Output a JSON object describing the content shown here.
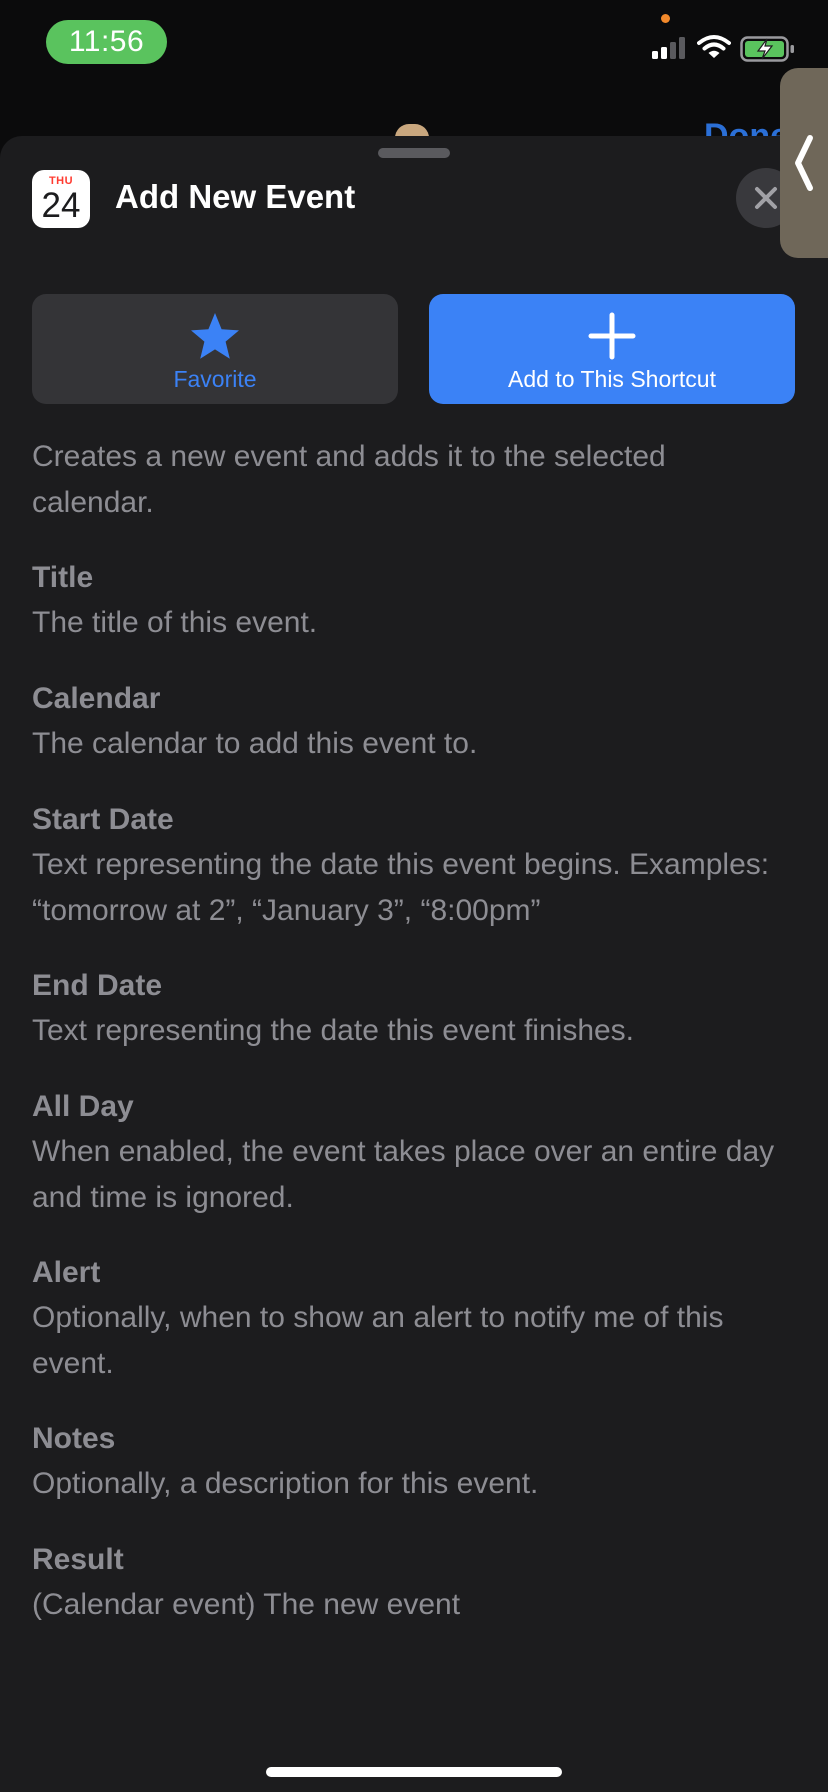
{
  "status_bar": {
    "time": "11:56",
    "signal_icon": "cellular-signal-icon",
    "wifi_icon": "wifi-icon",
    "battery_icon": "battery-charging-icon",
    "time_pill_color": "#5ac35e"
  },
  "background": {
    "nav_right_label": "Done"
  },
  "sheet": {
    "app_icon": {
      "day": "THU",
      "date": "24"
    },
    "title": "Add New Event",
    "close_icon": "close-icon",
    "buttons": {
      "favorite_label": "Favorite",
      "add_label": "Add to This Shortcut"
    },
    "description": "Creates a new event and adds it to the selected calendar.",
    "parameters": [
      {
        "name": "Title",
        "text": "The title of this event."
      },
      {
        "name": "Calendar",
        "text": "The calendar to add this event to."
      },
      {
        "name": "Start Date",
        "text": "Text representing the date this event begins. Examples: “tomorrow at 2”, “January 3”, “8:00pm”"
      },
      {
        "name": "End Date",
        "text": "Text representing the date this event finishes."
      },
      {
        "name": "All Day",
        "text": "When enabled, the event takes place over an entire day and time is ignored."
      },
      {
        "name": "Alert",
        "text": "Optionally, when to show an alert to notify me of this event."
      },
      {
        "name": "Notes",
        "text": "Optionally, a description for this event."
      },
      {
        "name": "Result",
        "text": "(Calendar event) The new event"
      }
    ]
  },
  "colors": {
    "accent": "#3b82f6",
    "sheet_bg": "#1c1c1e",
    "secondary_text": "#8d8d93"
  }
}
